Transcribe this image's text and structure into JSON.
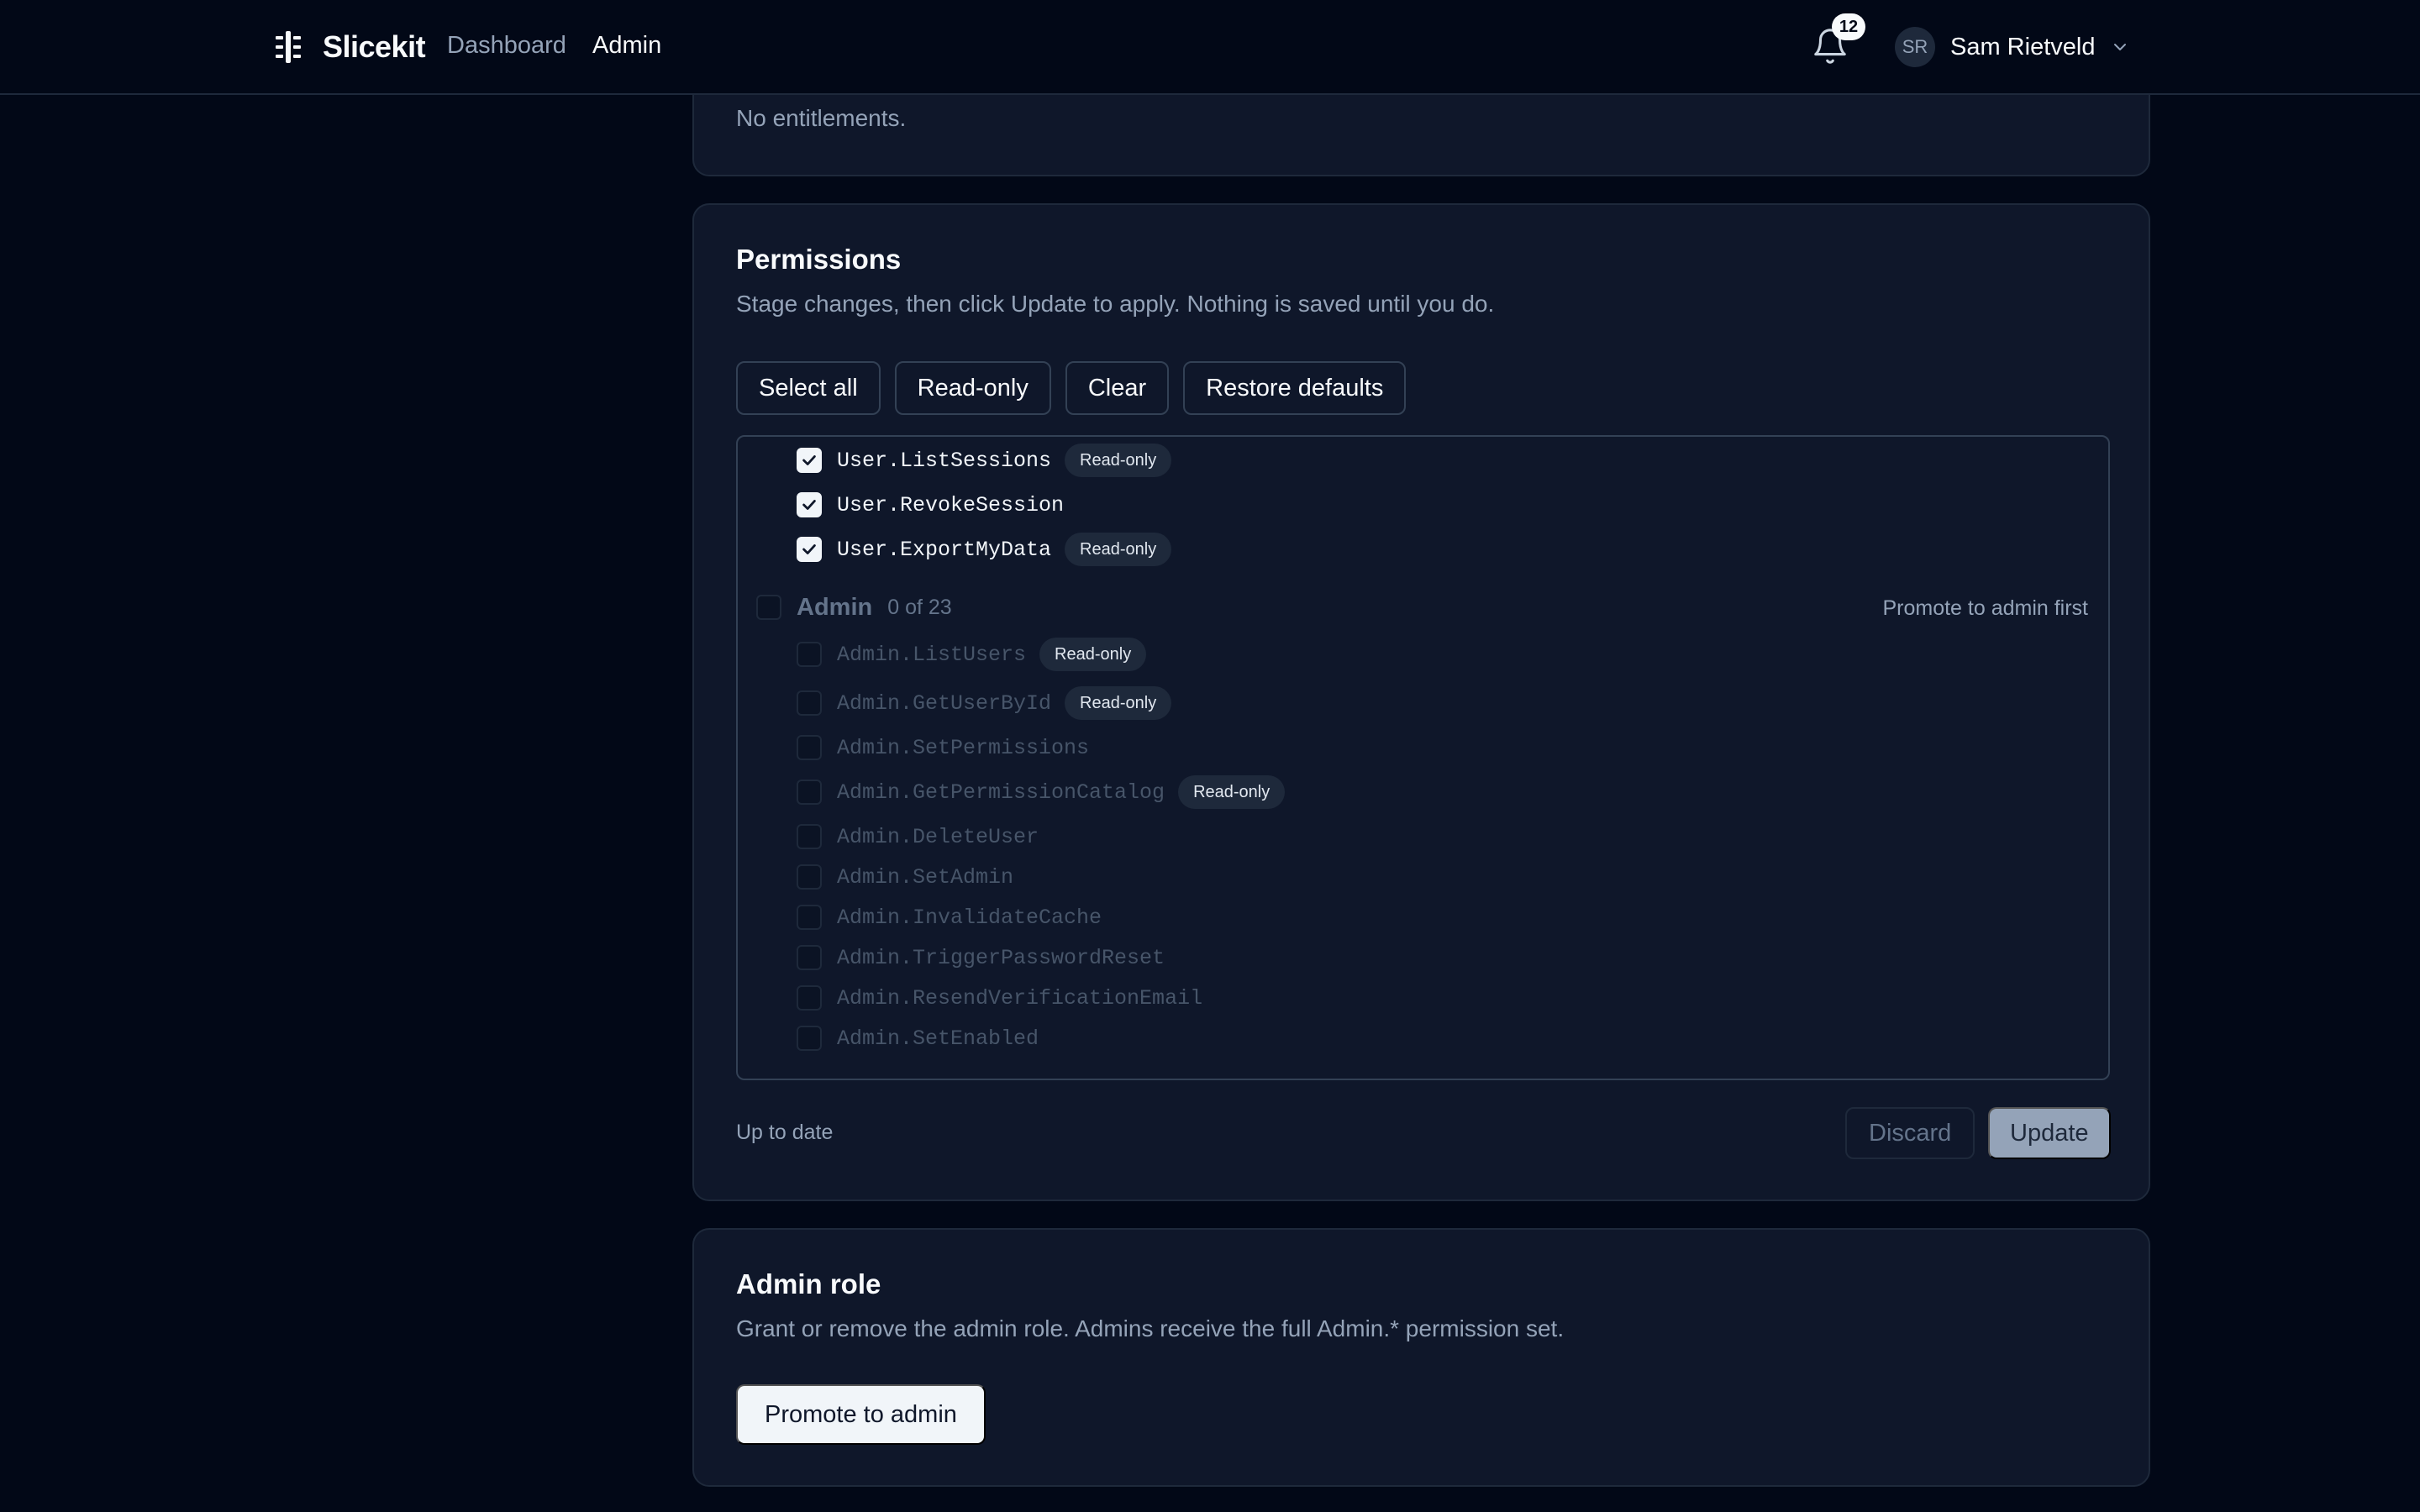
{
  "header": {
    "brand": "Slicekit",
    "nav": {
      "dashboard": "Dashboard",
      "admin": "Admin"
    },
    "notifications_count": "12",
    "user": {
      "initials": "SR",
      "name": "Sam Rietveld"
    }
  },
  "entitlements_card": {
    "empty_text": "No entitlements."
  },
  "permissions_card": {
    "title": "Permissions",
    "description": "Stage changes, then click Update to apply. Nothing is saved until you do.",
    "actions": {
      "select_all": "Select all",
      "read_only": "Read-only",
      "clear": "Clear",
      "restore_defaults": "Restore defaults"
    },
    "user_items": [
      {
        "name": "User.ListSessions",
        "checked": true,
        "badge": "Read-only"
      },
      {
        "name": "User.RevokeSession",
        "checked": true,
        "badge": ""
      },
      {
        "name": "User.ExportMyData",
        "checked": true,
        "badge": "Read-only"
      }
    ],
    "admin_group": {
      "name": "Admin",
      "count": "0 of 23",
      "note": "Promote to admin first",
      "items": [
        {
          "name": "Admin.ListUsers",
          "checked": false,
          "badge": "Read-only"
        },
        {
          "name": "Admin.GetUserById",
          "checked": false,
          "badge": "Read-only"
        },
        {
          "name": "Admin.SetPermissions",
          "checked": false,
          "badge": ""
        },
        {
          "name": "Admin.GetPermissionCatalog",
          "checked": false,
          "badge": "Read-only"
        },
        {
          "name": "Admin.DeleteUser",
          "checked": false,
          "badge": ""
        },
        {
          "name": "Admin.SetAdmin",
          "checked": false,
          "badge": ""
        },
        {
          "name": "Admin.InvalidateCache",
          "checked": false,
          "badge": ""
        },
        {
          "name": "Admin.TriggerPasswordReset",
          "checked": false,
          "badge": ""
        },
        {
          "name": "Admin.ResendVerificationEmail",
          "checked": false,
          "badge": ""
        },
        {
          "name": "Admin.SetEnabled",
          "checked": false,
          "badge": ""
        }
      ]
    },
    "status": "Up to date",
    "discard_label": "Discard",
    "update_label": "Update"
  },
  "admin_role_card": {
    "title": "Admin role",
    "description": "Grant or remove the admin role. Admins receive the full Admin.* permission set.",
    "promote_label": "Promote to admin"
  }
}
